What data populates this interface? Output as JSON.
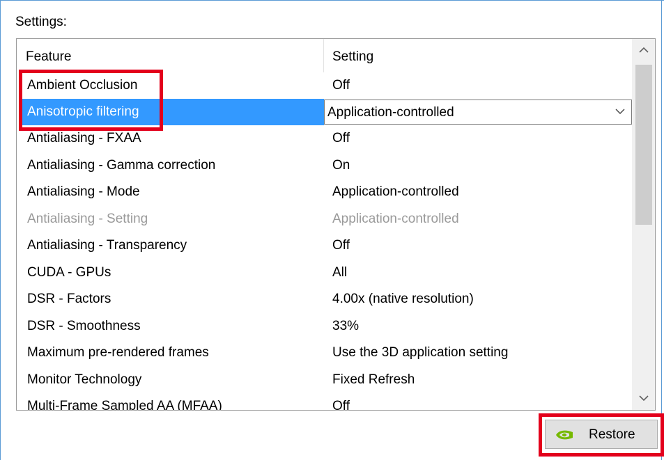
{
  "settings_label": "Settings:",
  "columns": {
    "feature": "Feature",
    "setting": "Setting"
  },
  "rows": [
    {
      "feature": "Ambient Occlusion",
      "setting": "Off"
    },
    {
      "feature": "Anisotropic filtering",
      "setting": "Application-controlled",
      "selected": true
    },
    {
      "feature": "Antialiasing - FXAA",
      "setting": "Off"
    },
    {
      "feature": "Antialiasing - Gamma correction",
      "setting": "On"
    },
    {
      "feature": "Antialiasing - Mode",
      "setting": "Application-controlled"
    },
    {
      "feature": "Antialiasing - Setting",
      "setting": "Application-controlled",
      "disabled": true
    },
    {
      "feature": "Antialiasing - Transparency",
      "setting": "Off"
    },
    {
      "feature": "CUDA - GPUs",
      "setting": "All"
    },
    {
      "feature": "DSR - Factors",
      "setting": "4.00x (native resolution)"
    },
    {
      "feature": "DSR - Smoothness",
      "setting": "33%"
    },
    {
      "feature": "Maximum pre-rendered frames",
      "setting": "Use the 3D application setting"
    },
    {
      "feature": "Monitor Technology",
      "setting": "Fixed Refresh"
    },
    {
      "feature": "Multi-Frame Sampled AA (MFAA)",
      "setting": "Off"
    }
  ],
  "restore_button": {
    "label": "Restore",
    "icon": "nvidia-logo-icon"
  },
  "colors": {
    "selection": "#3399ff",
    "highlight_box": "#e3001b",
    "frame": "#5b9bd5",
    "disabled_text": "#9a9a9a"
  }
}
